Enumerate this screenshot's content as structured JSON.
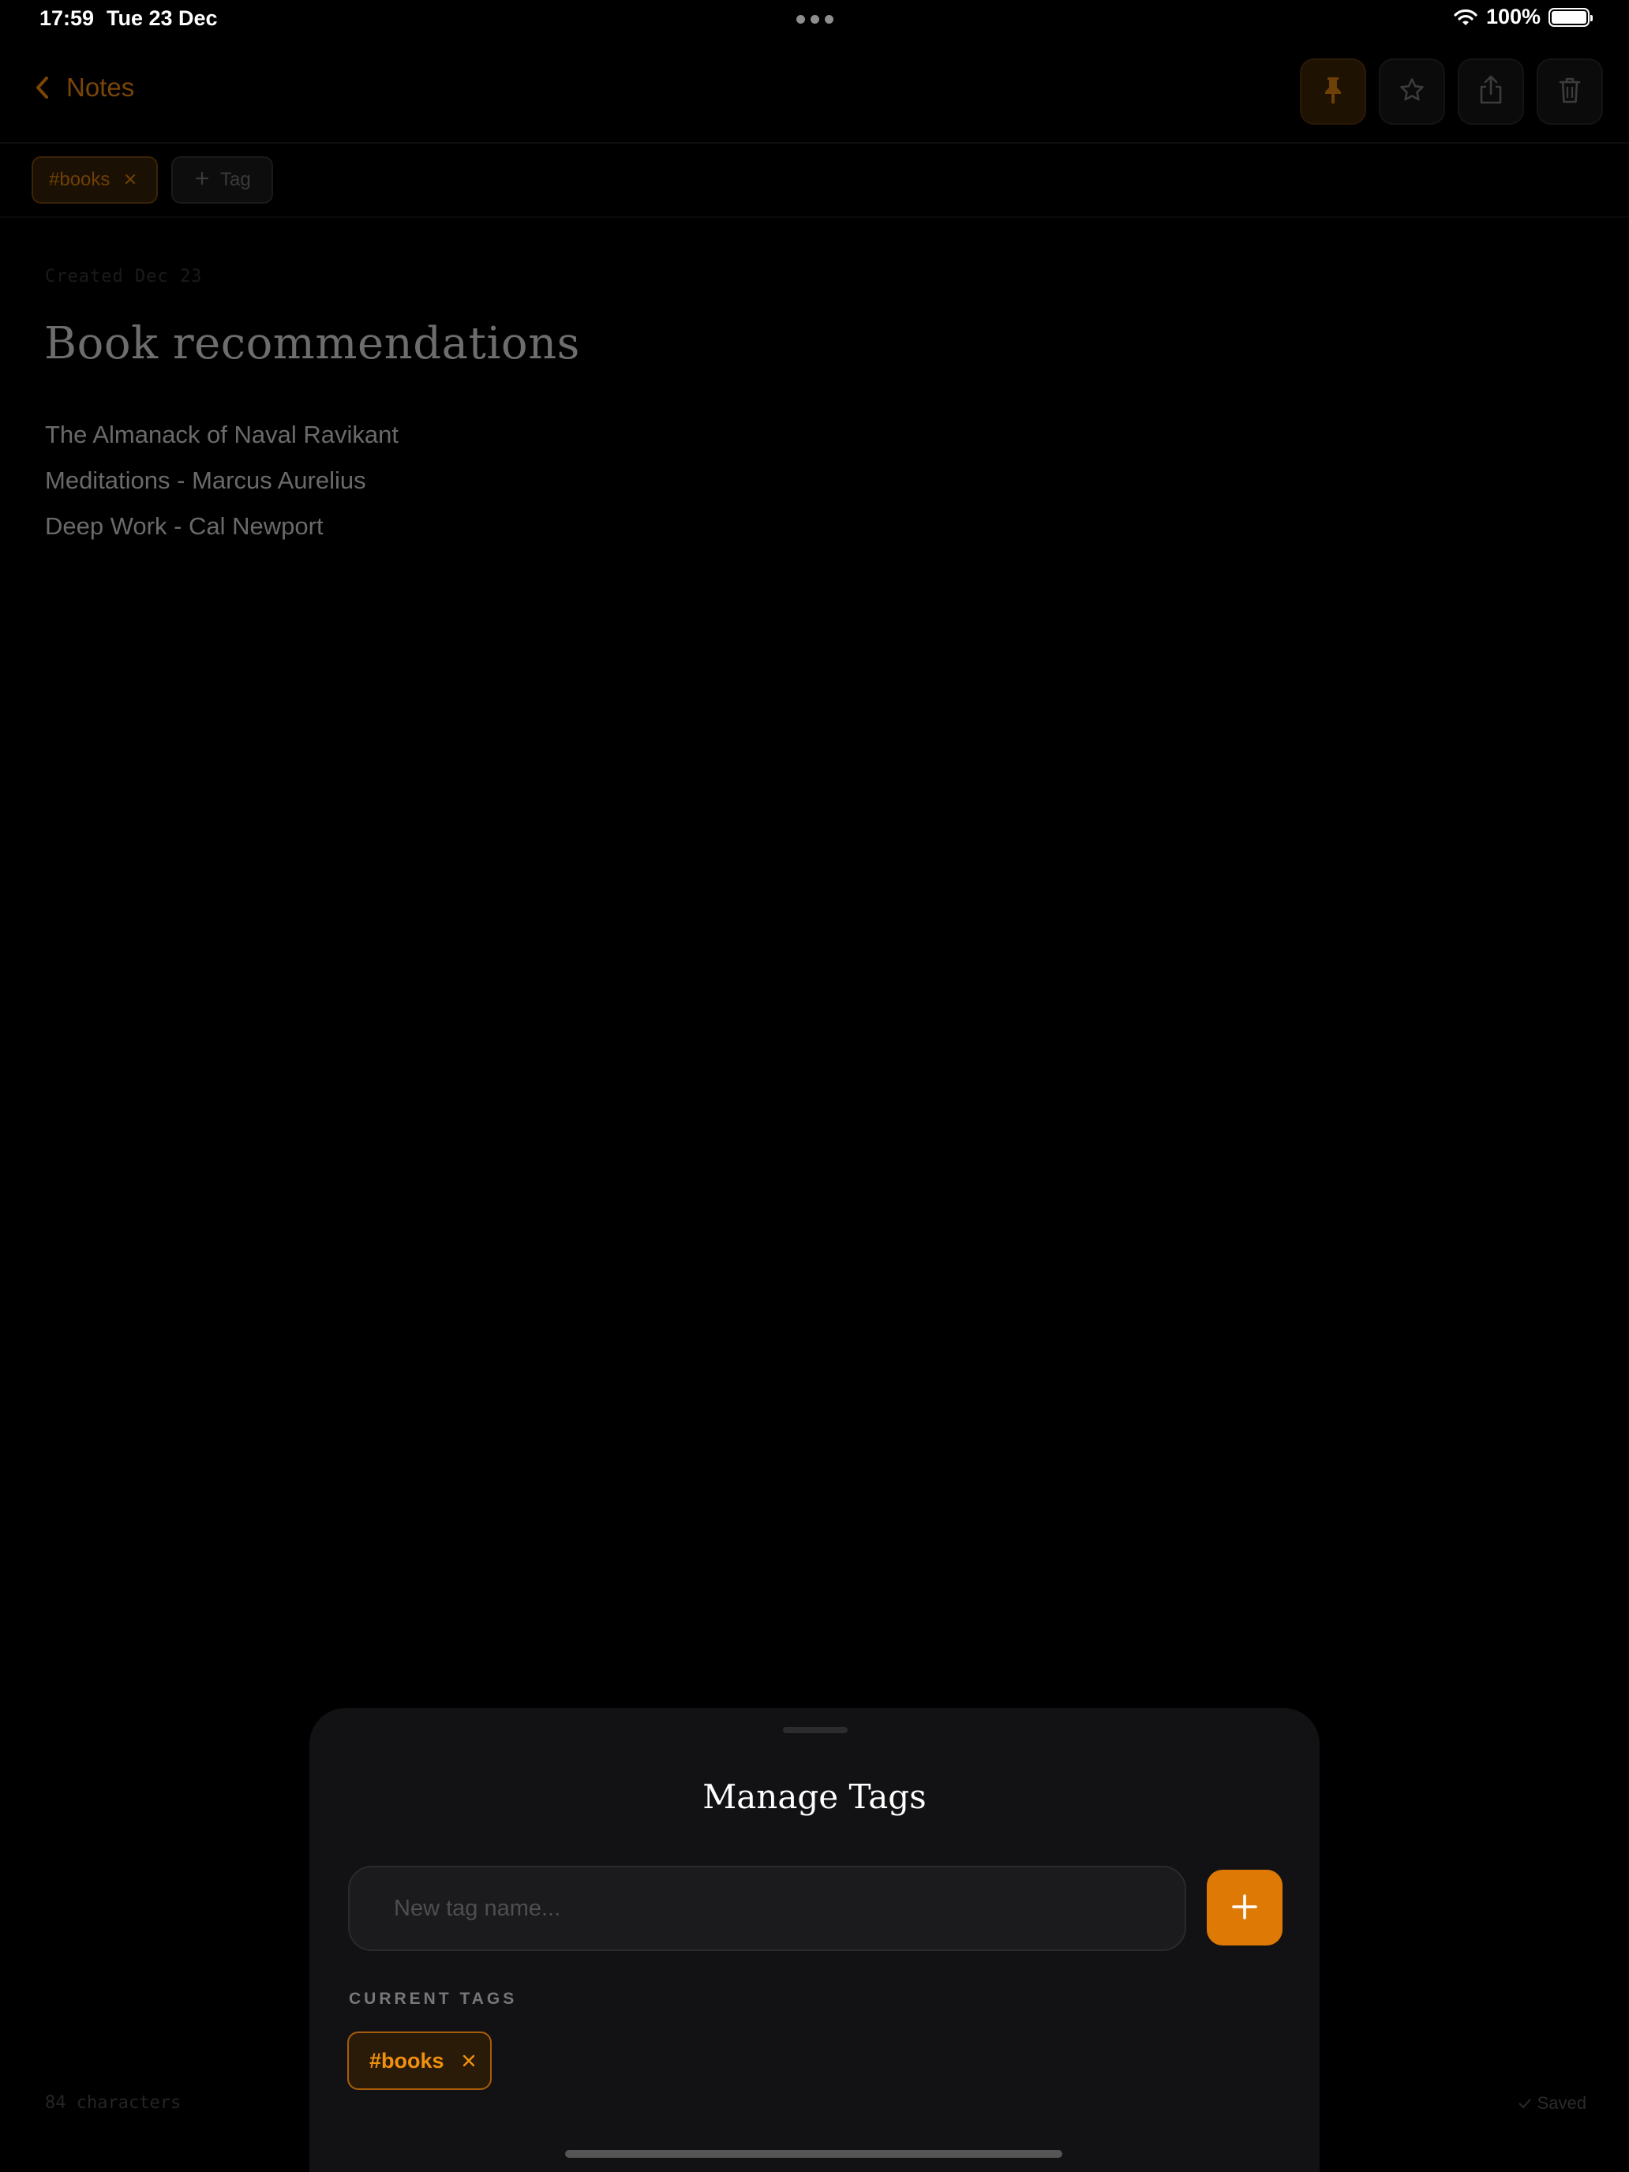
{
  "status_bar": {
    "time": "17:59",
    "date": "Tue 23 Dec",
    "battery": "100%",
    "battery_level": 1.0
  },
  "header": {
    "back_label": "Notes",
    "icons": [
      "chevron-left-icon",
      "pin-icon",
      "star-icon",
      "share-icon",
      "trash-icon"
    ]
  },
  "tags_bar": {
    "tag": "#books",
    "add_label": "Tag"
  },
  "note": {
    "created": "Created Dec 23",
    "title": "Book recommendations",
    "lines": [
      "The Almanack of Naval Ravikant",
      "Meditations - Marcus Aurelius",
      "Deep Work - Cal Newport"
    ]
  },
  "footer": {
    "char_count": "84 characters",
    "saved": "Saved"
  },
  "sheet": {
    "title": "Manage Tags",
    "input_placeholder": "New tag name...",
    "input_value": "",
    "section_label": "CURRENT TAGS",
    "tags": [
      "#books"
    ]
  },
  "colors": {
    "accent": "#dd7904",
    "background": "#000000",
    "sheet": "#121214"
  }
}
